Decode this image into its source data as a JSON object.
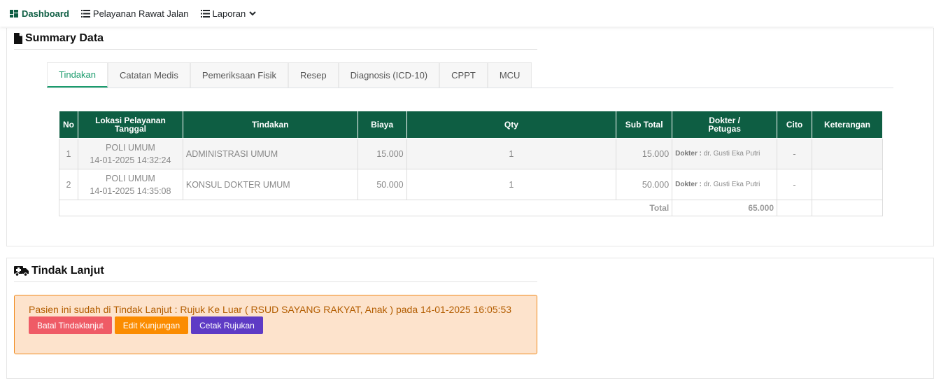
{
  "nav": {
    "items": [
      {
        "label": "Dashboard",
        "icon": "dashboard-icon"
      },
      {
        "label": "Pelayanan Rawat Jalan",
        "icon": "list-icon"
      },
      {
        "label": "Laporan",
        "icon": "list-icon"
      }
    ]
  },
  "summary": {
    "title": "Summary Data",
    "tabs": [
      "Tindakan",
      "Catatan Medis",
      "Pemeriksaan Fisik",
      "Resep",
      "Diagnosis (ICD-10)",
      "CPPT",
      "MCU"
    ],
    "active_tab": "Tindakan",
    "table": {
      "headers": {
        "no": "No",
        "lokasi_line1": "Lokasi Pelayanan",
        "lokasi_line2": "Tanggal",
        "tindakan": "Tindakan",
        "biaya": "Biaya",
        "qty": "Qty",
        "subtotal": "Sub Total",
        "dokter_line1": "Dokter /",
        "dokter_line2": "Petugas",
        "cito": "Cito",
        "keterangan": "Keterangan"
      },
      "rows": [
        {
          "no": "1",
          "lokasi": "POLI UMUM",
          "tanggal": "14-01-2025 14:32:24",
          "tindakan": "ADMINISTRASI UMUM",
          "biaya": "15.000",
          "qty": "1",
          "subtotal": "15.000",
          "dokter_label": "Dokter :",
          "dokter": "dr. Gusti Eka Putri",
          "cito": "-",
          "keterangan": ""
        },
        {
          "no": "2",
          "lokasi": "POLI UMUM",
          "tanggal": "14-01-2025 14:35:08",
          "tindakan": "KONSUL DOKTER UMUM",
          "biaya": "50.000",
          "qty": "1",
          "subtotal": "50.000",
          "dokter_label": "Dokter :",
          "dokter": "dr. Gusti Eka Putri",
          "cito": "-",
          "keterangan": ""
        }
      ],
      "total_label": "Total",
      "total_value": "65.000"
    }
  },
  "tindak_lanjut": {
    "title": "Tindak Lanjut",
    "alert_text": "Pasien ini sudah di Tindak Lanjut : Rujuk Ke Luar ( RSUD SAYANG RAKYAT, Anak ) pada 14-01-2025 16:05:53",
    "buttons": {
      "batal": "Batal Tindaklanjut",
      "edit": "Edit Kunjungan",
      "cetak": "Cetak Rujukan"
    }
  },
  "colors": {
    "primary_green": "#0e5e43",
    "tab_active": "#1a9b6c",
    "alert_bg": "#fde3cc",
    "alert_border": "#f08a1c",
    "alert_text": "#b35d00",
    "btn_danger": "#ef5b66",
    "btn_warning": "#fb8c00",
    "btn_primary": "#5e3bc5"
  }
}
